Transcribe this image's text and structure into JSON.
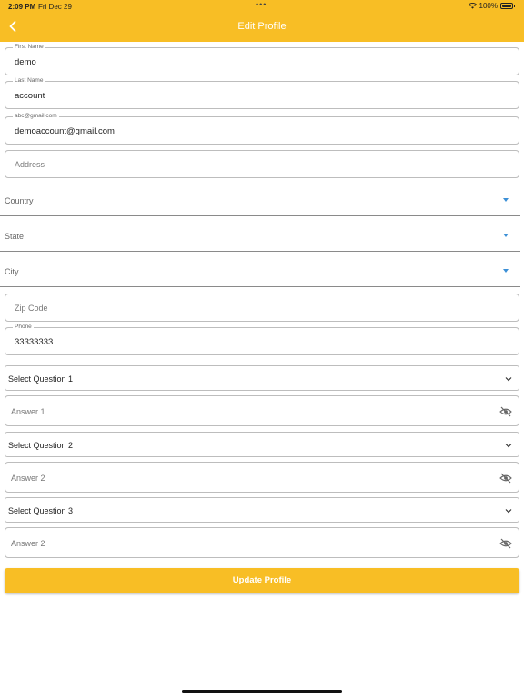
{
  "status_bar": {
    "time": "2:09 PM",
    "date": "Fri Dec 29",
    "battery": "100%"
  },
  "header": {
    "title": "Edit Profile",
    "back_icon": "chevron-left-icon"
  },
  "form": {
    "first_name": {
      "label": "First Name",
      "value": "demo"
    },
    "last_name": {
      "label": "Last Name",
      "value": "account"
    },
    "email": {
      "label": "abc@gmail.com",
      "value": "demoaccount@gmail.com"
    },
    "address": {
      "placeholder": "Address"
    },
    "country": {
      "label": "Country"
    },
    "state": {
      "label": "State"
    },
    "city": {
      "label": "City"
    },
    "zip": {
      "placeholder": "Zip Code"
    },
    "phone": {
      "label": "Phone",
      "value": "33333333"
    },
    "question1": {
      "label": "Select Question 1"
    },
    "answer1": {
      "placeholder": "Answer 1"
    },
    "question2": {
      "label": "Select Question 2"
    },
    "answer2": {
      "placeholder": "Answer 2"
    },
    "question3": {
      "label": "Select Question 3"
    },
    "answer3": {
      "placeholder": "Answer 2"
    }
  },
  "actions": {
    "update_label": "Update Profile"
  },
  "colors": {
    "accent": "#f8be25",
    "caret": "#3b8fd6",
    "border": "#bdbdbd"
  }
}
